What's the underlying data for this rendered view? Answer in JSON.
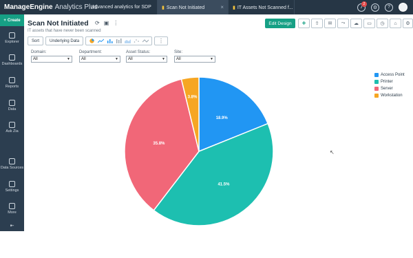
{
  "app": {
    "brand_name": "ManageEngine",
    "brand_product": "Analytics Plus"
  },
  "tabs": [
    {
      "label": "Advanced analytics for SDP"
    },
    {
      "label": "Scan Not Initiated"
    },
    {
      "label": "IT Assets Not Scanned f..."
    }
  ],
  "notifications": {
    "count": "2"
  },
  "sidebar": {
    "create_label": "Create",
    "items": [
      {
        "label": "Explorer",
        "icon": "explorer-icon"
      },
      {
        "label": "Dashboards",
        "icon": "dashboards-icon"
      },
      {
        "label": "Reports",
        "icon": "reports-icon"
      },
      {
        "label": "Data",
        "icon": "data-icon"
      },
      {
        "label": "Ask Zia",
        "icon": "ask-zia-icon"
      },
      {
        "label": "Data Sources",
        "icon": "data-sources-icon"
      },
      {
        "label": "Settings",
        "icon": "settings-icon"
      },
      {
        "label": "More",
        "icon": "more-icon"
      }
    ]
  },
  "report": {
    "title": "Scan Not Initiated",
    "subtitle": "IT assets that have never been scanned",
    "edit_design_label": "Edit Design"
  },
  "toolbar": {
    "sort_label": "Sort",
    "underlying_data_label": "Underlying Data"
  },
  "filters": [
    {
      "label": "Domain:",
      "value": "All"
    },
    {
      "label": "Department:",
      "value": "All"
    },
    {
      "label": "Asset Status:",
      "value": "All"
    },
    {
      "label": "Site:",
      "value": "All"
    }
  ],
  "chart_data": {
    "type": "pie",
    "legend_position": "right",
    "series": [
      {
        "name": "Access Point",
        "value": 18.9,
        "label": "18.9%",
        "color": "#2196f3"
      },
      {
        "name": "Printer",
        "value": 41.5,
        "label": "41.5%",
        "color": "#1dbfb0"
      },
      {
        "name": "Server",
        "value": 35.8,
        "label": "35.8%",
        "color": "#f16778"
      },
      {
        "name": "Workstation",
        "value": 3.8,
        "label": "3.8%",
        "color": "#f6a623"
      }
    ]
  }
}
